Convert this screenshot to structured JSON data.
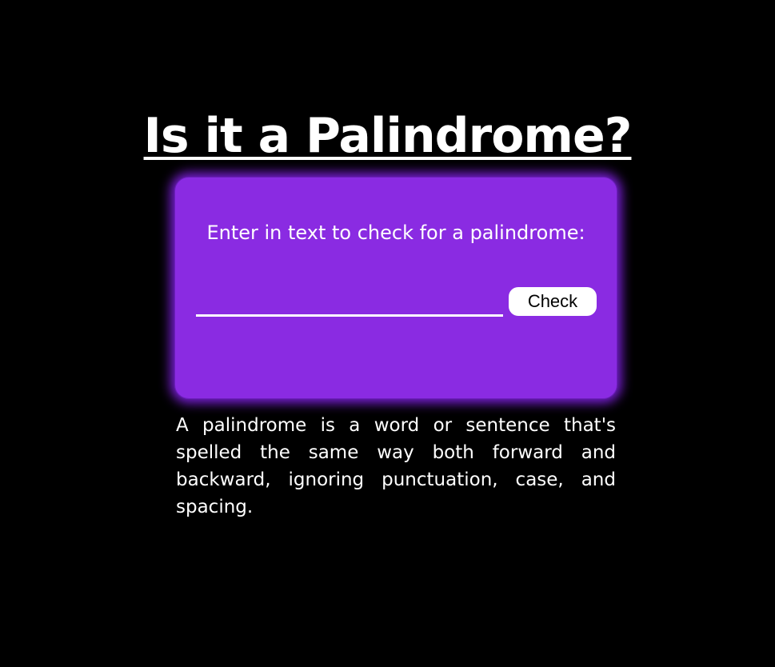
{
  "header": {
    "title": "Is it a Palindrome?"
  },
  "checker": {
    "prompt": "Enter in text to check for a palindrome:",
    "input_value": "",
    "button_label": "Check"
  },
  "info": {
    "definition": "A palindrome is a word or sentence that's spelled the same way both forward and backward, ignoring punctuation, case, and spacing."
  },
  "colors": {
    "background": "#000000",
    "card": "#8a2be2",
    "card_glow": "#7b1fd8",
    "text": "#ffffff",
    "button": "#ffffff"
  }
}
